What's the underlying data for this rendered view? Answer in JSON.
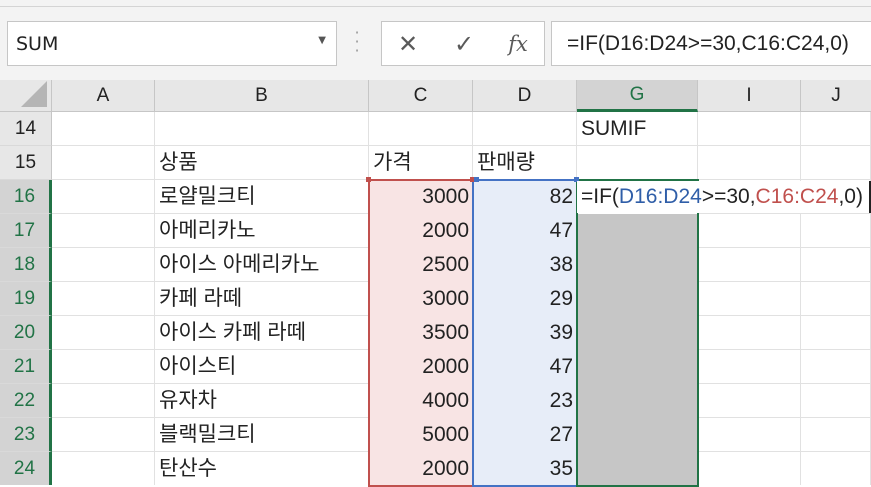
{
  "formula_bar": {
    "name_box": "SUM",
    "cancel_icon": "close-icon",
    "enter_icon": "checkmark-icon",
    "fx_label": "fx",
    "formula": "=IF(D16:D24>=30,C16:C24,0)"
  },
  "columns": [
    "A",
    "B",
    "C",
    "D",
    "G",
    "I",
    "J"
  ],
  "rows": [
    {
      "num": "14",
      "B": "",
      "C": "",
      "D": "",
      "G": "SUMIF"
    },
    {
      "num": "15",
      "B": "상품",
      "C": "가격",
      "D": "판매량",
      "G": ""
    },
    {
      "num": "16",
      "B": "로얄밀크티",
      "C": "3000",
      "D": "82",
      "G": ""
    },
    {
      "num": "17",
      "B": "아메리카노",
      "C": "2000",
      "D": "47",
      "G": ""
    },
    {
      "num": "18",
      "B": "아이스 아메리카노",
      "C": "2500",
      "D": "38",
      "G": ""
    },
    {
      "num": "19",
      "B": "카페 라떼",
      "C": "3000",
      "D": "29",
      "G": ""
    },
    {
      "num": "20",
      "B": "아이스 카페 라떼",
      "C": "3500",
      "D": "39",
      "G": ""
    },
    {
      "num": "21",
      "B": "아이스티",
      "C": "2000",
      "D": "47",
      "G": ""
    },
    {
      "num": "22",
      "B": "유자차",
      "C": "4000",
      "D": "23",
      "G": ""
    },
    {
      "num": "23",
      "B": "블랙밀크티",
      "C": "5000",
      "D": "27",
      "G": ""
    },
    {
      "num": "24",
      "B": "탄산수",
      "C": "2000",
      "D": "35",
      "G": ""
    }
  ],
  "cell_editor": {
    "prefix": "=IF(",
    "ref1": "D16:D24",
    "middle": ">=30,",
    "ref2": "C16:C24",
    "suffix": ",0)"
  },
  "colors": {
    "accent_green": "#217346",
    "ref_red": "#c0504d",
    "ref_blue": "#4472c4"
  }
}
